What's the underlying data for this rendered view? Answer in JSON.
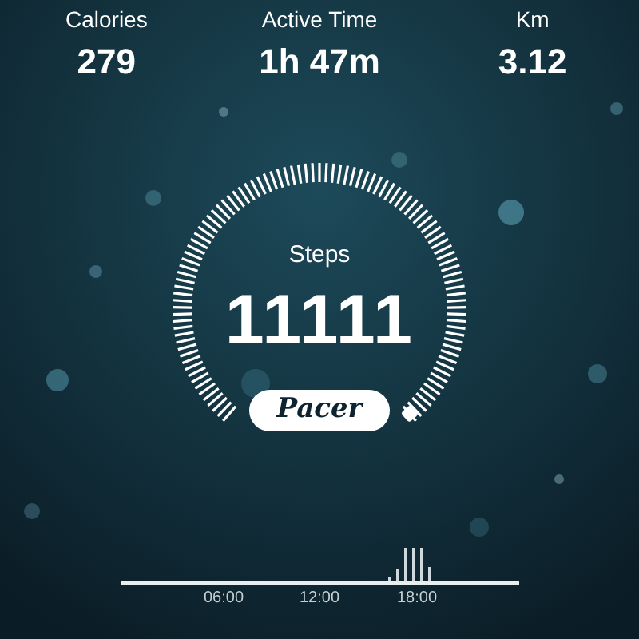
{
  "stats": [
    {
      "label": "Calories",
      "value": "279"
    },
    {
      "label": "Active Time",
      "value": "1h 47m"
    },
    {
      "label": "Km",
      "value": "3.12"
    }
  ],
  "gauge": {
    "label": "Steps",
    "value": "11111"
  },
  "brand": "Pacer",
  "timeline": {
    "ticks": [
      "06:00",
      "12:00",
      "18:00"
    ]
  }
}
